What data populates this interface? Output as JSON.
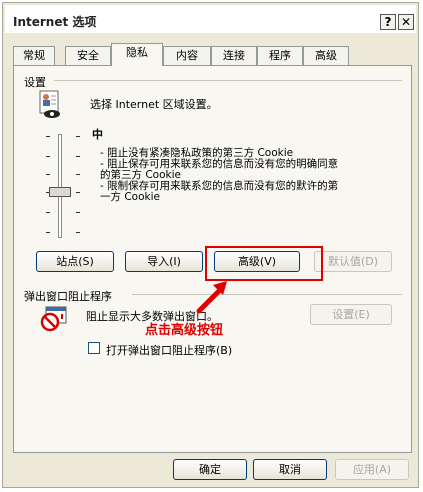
{
  "window": {
    "title": "Internet 选项",
    "help_button": "?",
    "close_button": "✕"
  },
  "tabs": [
    {
      "label": "常规"
    },
    {
      "label": "安全"
    },
    {
      "label": "隐私"
    },
    {
      "label": "内容"
    },
    {
      "label": "连接"
    },
    {
      "label": "程序"
    },
    {
      "label": "高级"
    }
  ],
  "active_tab": "隐私",
  "settings": {
    "group_title": "设置",
    "instruction": "选择 Internet 区域设置。",
    "level": "中",
    "description_lines": [
      "- 阻止没有紧凑隐私政策的第三方 Cookie",
      "- 阻止保存可用来联系您的信息而没有您的明确同意",
      "的第三方 Cookie",
      "- 限制保存可用来联系您的信息而没有您的默许的第",
      "一方 Cookie"
    ],
    "buttons": {
      "sites": "站点(S)",
      "import": "导入(I)",
      "advanced": "高级(V)",
      "default": "默认值(D)"
    }
  },
  "popup_blocker": {
    "group_title": "弹出窗口阻止程序",
    "description": "阻止显示大多数弹出窗口。",
    "settings_button": "设置(E)",
    "enable_checkbox_label": "打开弹出窗口阻止程序(B)",
    "enable_checked": false
  },
  "annotation": {
    "text": "点击高级按钮",
    "color": "#e00000"
  },
  "footer": {
    "ok": "确定",
    "cancel": "取消",
    "apply": "应用(A)"
  }
}
